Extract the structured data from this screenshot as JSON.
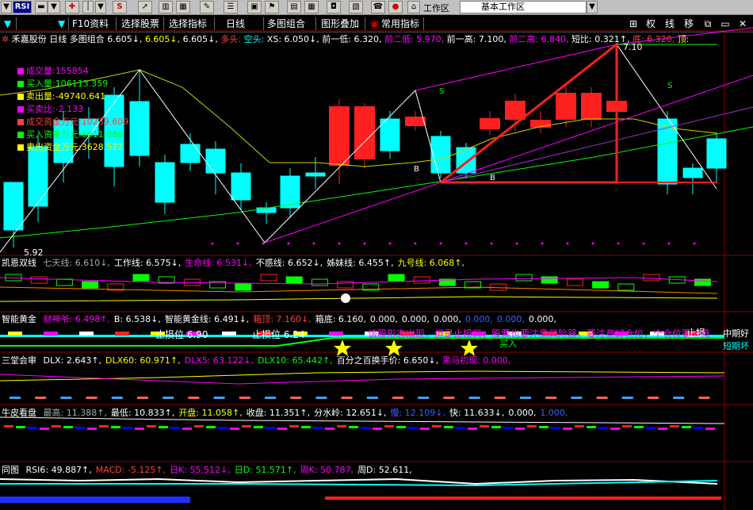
{
  "toolbar_top": {
    "logo": "RSI",
    "workspace_label": "工作区",
    "workspace_value": "基本工作区"
  },
  "toolbar_main": {
    "items": [
      "F10资料",
      "选择股票",
      "选择指标",
      "日线",
      "多图组合",
      "图形叠加",
      "常用指标"
    ],
    "right_buttons": [
      "权",
      "线",
      "移"
    ]
  },
  "header": {
    "stock": "禾嘉股份",
    "period": "日线",
    "mode": "多图组合",
    "v1": "6.605↓,",
    "v2": "6.605↓,",
    "v3": "6.605↓,",
    "duotou": "多头:",
    "kongtou": "空头:",
    "xs": "XS: 6.050↓,",
    "qianyidi": "前一低: 6.320,",
    "qianerdi": "前二低: 5.970,",
    "qianyigao": "前一高: 7.100,",
    "qianergao": "前二高: 6.840,",
    "duanbi": "短比: 0.321↑,",
    "di": "底: 6.320,",
    "ding": "顶:"
  },
  "legend": [
    {
      "label": "成交量:155854",
      "color": "#ff00ff"
    },
    {
      "label": "买入量:106113.359",
      "color": "#00ff00"
    },
    {
      "label": "卖出量:-49740.641",
      "color": "#ffff00"
    },
    {
      "label": "买卖比:-2.133",
      "color": "#ff00ff"
    },
    {
      "label": "成交资金万元:10239.609",
      "color": "#ff4040"
    },
    {
      "label": "买入资金万元:6611.086",
      "color": "#00ff00"
    },
    {
      "label": "卖出资金万元:3628.522",
      "color": "#ffff00"
    }
  ],
  "main_chart": {
    "price_high_label": "7.10",
    "price_low_label": "5.92",
    "b_label": "B",
    "s_label": "S"
  },
  "panel2": {
    "title": "凯恩双线",
    "items": [
      {
        "text": "七天线: 6.610↓,",
        "color": "#aaaaaa"
      },
      {
        "text": "工作线: 6.575↓,",
        "color": "#ffffff"
      },
      {
        "text": "生命线: 6.531↓,",
        "color": "#ff00ff"
      },
      {
        "text": "不惑线: 6.652↓,",
        "color": "#ffffff"
      },
      {
        "text": "姊妹线: 6.455↑,",
        "color": "#ffffff"
      },
      {
        "text": "九号线: 6.068↑,",
        "color": "#ffff00"
      }
    ]
  },
  "panel3": {
    "title": "智能黄金",
    "items": [
      {
        "text": "财神爷: 6.498↑,",
        "color": "#ff00ff"
      },
      {
        "text": "B: 6.538↓,",
        "color": "#ffffff"
      },
      {
        "text": "智能黄金线: 6.491↓,",
        "color": "#ffffff"
      },
      {
        "text": "箱顶: 7.160↓,",
        "color": "#ff4040"
      },
      {
        "text": "箱底: 6.160,",
        "color": "#ffffff"
      },
      {
        "text": "0.000,",
        "color": "#ffffff"
      },
      {
        "text": "0.000,",
        "color": "#ffffff"
      },
      {
        "text": "0.000,",
        "color": "#ffffff"
      },
      {
        "text": "0.000,",
        "color": "#4060ff"
      },
      {
        "text": "0.000,",
        "color": "#4060ff"
      },
      {
        "text": "0.000,",
        "color": "#ffffff"
      }
    ],
    "stop1": "止损位 6.90",
    "stop2": "止损位 6.24",
    "stop3": "止损",
    "notice": "该股形态出现，但是止损只，股票也要注意风险器，要注意好仓位，个仓位要注意",
    "buy_label": "买入",
    "mid": "中期好",
    "short": "短期坏"
  },
  "panel4": {
    "title": "三堂会审",
    "items": [
      {
        "text": "DLX: 2.643↑,",
        "color": "#ffffff"
      },
      {
        "text": "DLX60: 60.971↑,",
        "color": "#ffff00"
      },
      {
        "text": "DLX5: 63.122↓,",
        "color": "#ff00ff"
      },
      {
        "text": "DLX10: 65.442↑,",
        "color": "#00ff00"
      },
      {
        "text": "百分之百换手价: 6.650↓,",
        "color": "#ffffff"
      },
      {
        "text": "黑马初现: 0.000,",
        "color": "#ff00ff"
      }
    ]
  },
  "panel5": {
    "title": "牛皮看盘",
    "items": [
      {
        "text": "最高: 11.388↑,",
        "color": "#aaaaaa"
      },
      {
        "text": "最低: 10.833↑,",
        "color": "#ffffff"
      },
      {
        "text": "开盘: 11.058↑,",
        "color": "#ffff00"
      },
      {
        "text": "收盘: 11.351↑,",
        "color": "#ffffff"
      },
      {
        "text": "分水岭: 12.651↓,",
        "color": "#ffffff"
      },
      {
        "text": "慢: 12.109↓,",
        "color": "#4060ff"
      },
      {
        "text": "快: 11.633↓,",
        "color": "#ffffff"
      },
      {
        "text": "0.000,",
        "color": "#ffffff"
      },
      {
        "text": "1.000,",
        "color": "#4060ff"
      }
    ]
  },
  "panel6": {
    "title": "同图",
    "items": [
      {
        "text": "RSI6: 49.887↑,",
        "color": "#ffffff"
      },
      {
        "text": "MACD: -5.125↑,",
        "color": "#ff4040"
      },
      {
        "text": "日K: 55.512↓,",
        "color": "#ff00ff"
      },
      {
        "text": "日D: 51.571↑,",
        "color": "#00ff00"
      },
      {
        "text": "周K: 50.787,",
        "color": "#ff00ff"
      },
      {
        "text": "周D: 52.611,",
        "color": "#ffffff"
      }
    ]
  },
  "colors": {
    "up": "#ff2020",
    "down": "#00ffff",
    "bg": "#000000"
  },
  "icons": [
    "plus-icon",
    "dollar-icon",
    "arrow-icon",
    "zoom-icon",
    "close-icon"
  ]
}
